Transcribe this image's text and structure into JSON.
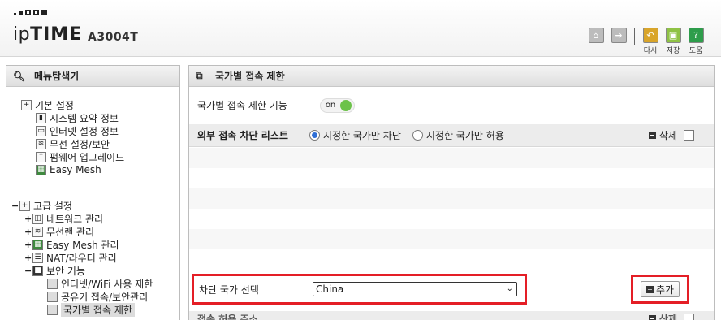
{
  "header": {
    "brand_prefix": "ip",
    "brand_bold": "TIME",
    "model": "A3004T",
    "icons": [
      {
        "name": "home-icon",
        "label": "",
        "color": "#bcbcbc"
      },
      {
        "name": "logout-icon",
        "label": "",
        "color": "#bcbcbc"
      },
      {
        "name": "undo-icon",
        "label": "다시",
        "color": "#d9a52a"
      },
      {
        "name": "save-icon",
        "label": "저장",
        "color": "#8fc245"
      },
      {
        "name": "help-icon",
        "label": "도움",
        "color": "#2e9d4b"
      }
    ]
  },
  "sidebar": {
    "title": "메뉴탐색기",
    "basic_group": "기본 설정",
    "basic_items": [
      "시스템 요약 정보",
      "인터넷 설정 정보",
      "무선 설정/보안",
      "펌웨어 업그레이드",
      "Easy Mesh"
    ],
    "advanced_group": "고급 설정",
    "advanced_items": [
      "네트워크 관리",
      "무선랜 관리",
      "Easy Mesh 관리",
      "NAT/라우터 관리",
      "보안 기능"
    ],
    "security_items": [
      "인터넷/WiFi 사용 제한",
      "공유기 접속/보안관리",
      "국가별 접속 제한"
    ]
  },
  "main": {
    "title": "국가별 접속 제한",
    "func_label": "국가별 접속 제한 기능",
    "toggle_label": "on",
    "list_title": "외부 접속 차단 리스트",
    "radio_block": "지정한 국가만 차단",
    "radio_allow": "지정한 국가만 허용",
    "delete_label": "삭제",
    "select_label": "차단 국가 선택",
    "select_value": "China",
    "add_label": "추가",
    "bottom_title": "접속 허용 주소",
    "bottom_delete": "삭제"
  },
  "colors": {
    "highlight": "#e41e26",
    "toggle_on": "#6cc24a",
    "radio_selected": "#2f6fd6"
  }
}
